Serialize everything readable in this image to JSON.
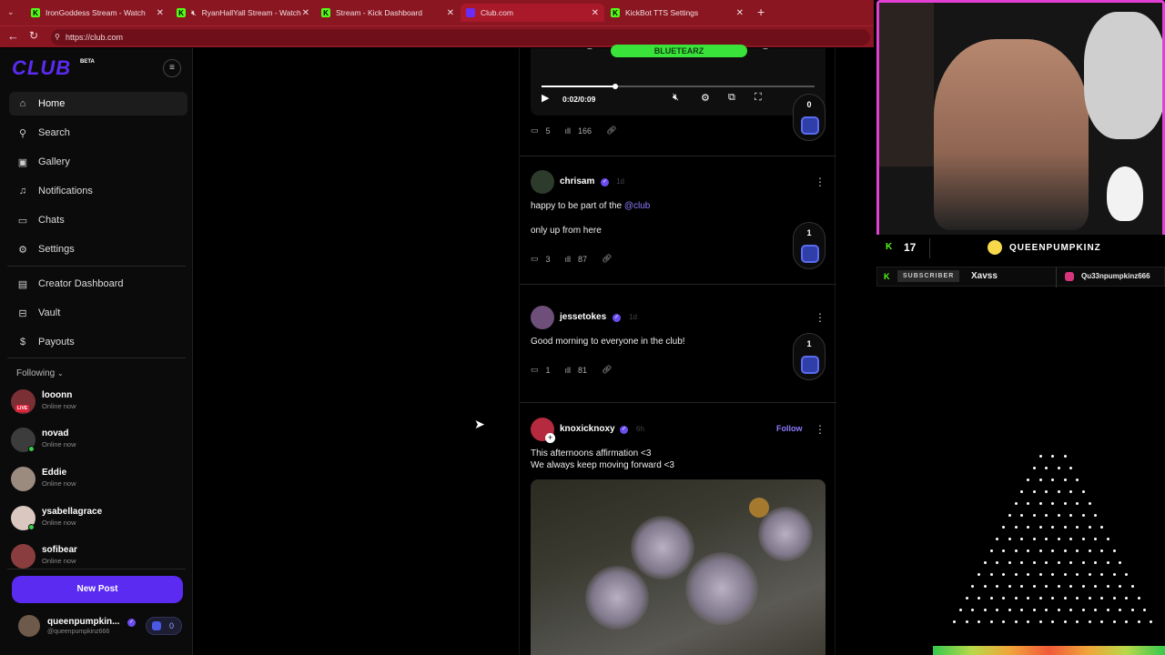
{
  "browser": {
    "tabs": [
      {
        "title": "IronGoddess Stream - Watch",
        "icon": "kick-icon"
      },
      {
        "title": "RyanHallYall Stream - Watch",
        "icon": "kick-icon"
      },
      {
        "title": "Stream - Kick Dashboard",
        "icon": "kick-icon"
      },
      {
        "title": "Club.com",
        "icon": "club-icon",
        "active": true
      },
      {
        "title": "KickBot TTS Settings",
        "icon": "kick-icon"
      }
    ],
    "url": "https://club.com"
  },
  "sidebar": {
    "logo": "CLUB",
    "logo_tag": "BETA",
    "nav": [
      {
        "label": "Home",
        "icon": "home-icon"
      },
      {
        "label": "Search",
        "icon": "search-icon"
      },
      {
        "label": "Gallery",
        "icon": "gallery-icon"
      },
      {
        "label": "Notifications",
        "icon": "bell-icon"
      },
      {
        "label": "Chats",
        "icon": "chat-icon"
      },
      {
        "label": "Settings",
        "icon": "gear-icon"
      },
      {
        "label": "Creator Dashboard",
        "icon": "dashboard-icon"
      },
      {
        "label": "Vault",
        "icon": "vault-icon"
      },
      {
        "label": "Payouts",
        "icon": "payouts-icon"
      }
    ],
    "following_label": "Following",
    "following": [
      {
        "name": "looonn",
        "status": "Online now",
        "live": "LIVE"
      },
      {
        "name": "novad",
        "status": "Online now"
      },
      {
        "name": "Eddie",
        "status": "Online now"
      },
      {
        "name": "ysabellagrace",
        "status": "Online now"
      },
      {
        "name": "sofibear",
        "status": "Online now"
      }
    ],
    "new_post": "New Post",
    "profile": {
      "name": "queenpumpkin...",
      "handle": "@queenpumpkinz666",
      "coins": "0"
    }
  },
  "feed": {
    "video": {
      "label": "BLUETEARZ",
      "time": "0:02/0:09",
      "progress": 0.27,
      "comments": "5",
      "views": "166",
      "badge": "0"
    },
    "posts": [
      {
        "user": "chrisam",
        "age": "1d",
        "lines": [
          "happy to be part of the",
          "@club",
          "only up from here"
        ],
        "comments": "3",
        "views": "87",
        "badge": "1"
      },
      {
        "user": "jessetokes",
        "age": "1d",
        "lines": [
          "Good morning to everyone in the club!"
        ],
        "comments": "1",
        "views": "81",
        "badge": "1"
      },
      {
        "user": "knoxicknoxy",
        "age": "6h",
        "follow": "Follow",
        "lines": [
          "This afternoons affirmation <3",
          "We always keep moving forward <3"
        ]
      }
    ]
  },
  "overlay": {
    "kick_count": "17",
    "streamer": "QUEENPUMPKINZ",
    "sub_label": "SUBSCRIBER",
    "sub_name": "Xavss",
    "ig_handle": "Qu33npumpkinz666"
  }
}
